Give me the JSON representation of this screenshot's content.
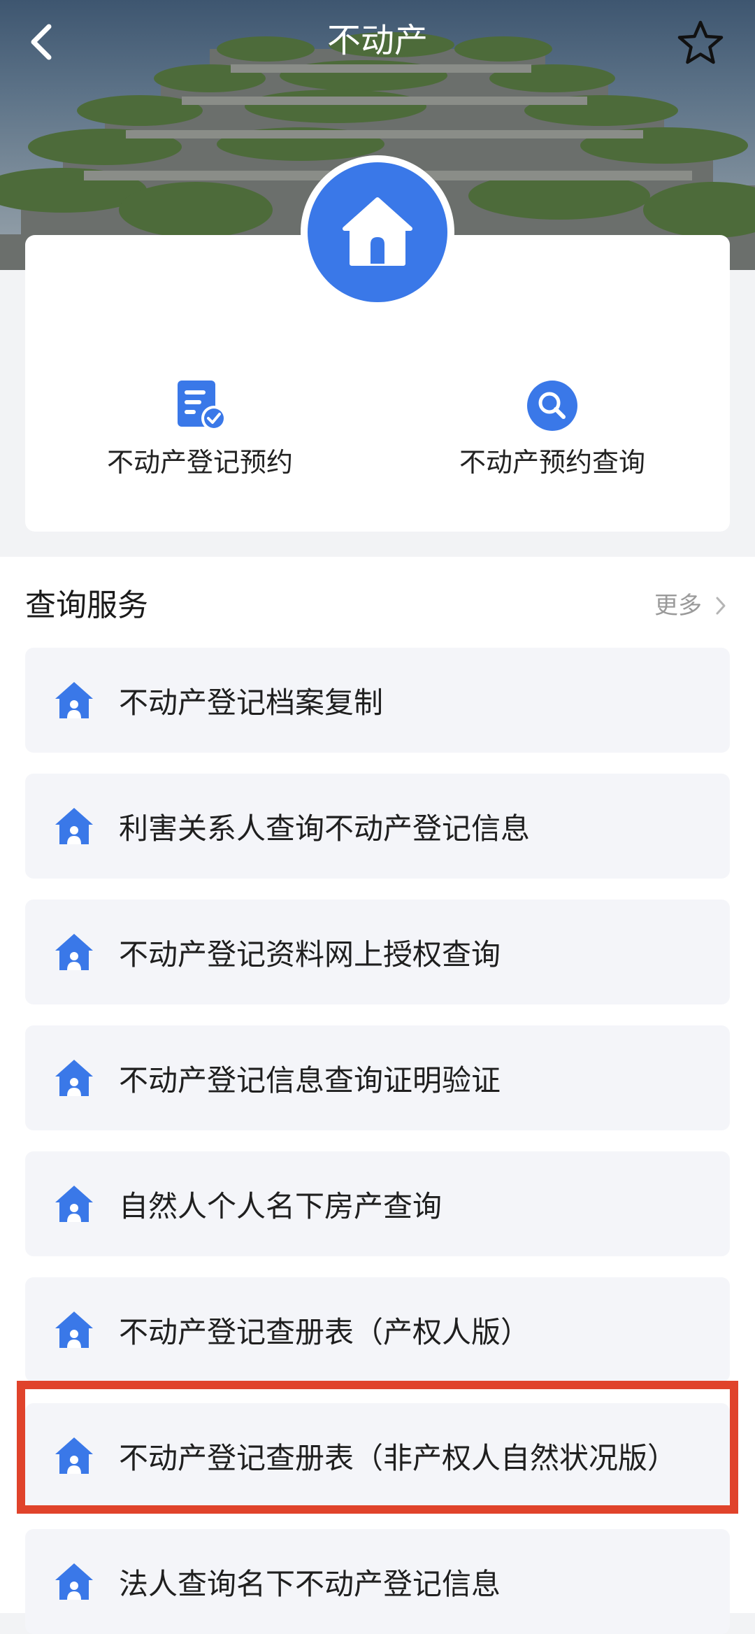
{
  "header": {
    "title": "不动产"
  },
  "quick_actions": [
    {
      "label": "不动产登记预约",
      "icon": "document-check-icon"
    },
    {
      "label": "不动产预约查询",
      "icon": "search-icon"
    }
  ],
  "section": {
    "title": "查询服务",
    "more_label": "更多"
  },
  "services": [
    {
      "label": "不动产登记档案复制"
    },
    {
      "label": "利害关系人查询不动产登记信息"
    },
    {
      "label": "不动产登记资料网上授权查询"
    },
    {
      "label": "不动产登记信息查询证明验证"
    },
    {
      "label": "自然人个人名下房产查询"
    },
    {
      "label": "不动产登记查册表（产权人版）"
    },
    {
      "label": "不动产登记查册表（非产权人自然状况版）",
      "highlighted": true
    },
    {
      "label": "法人查询名下不动产登记信息"
    }
  ],
  "colors": {
    "accent": "#3a78e8",
    "highlight_border": "#e0432b"
  }
}
